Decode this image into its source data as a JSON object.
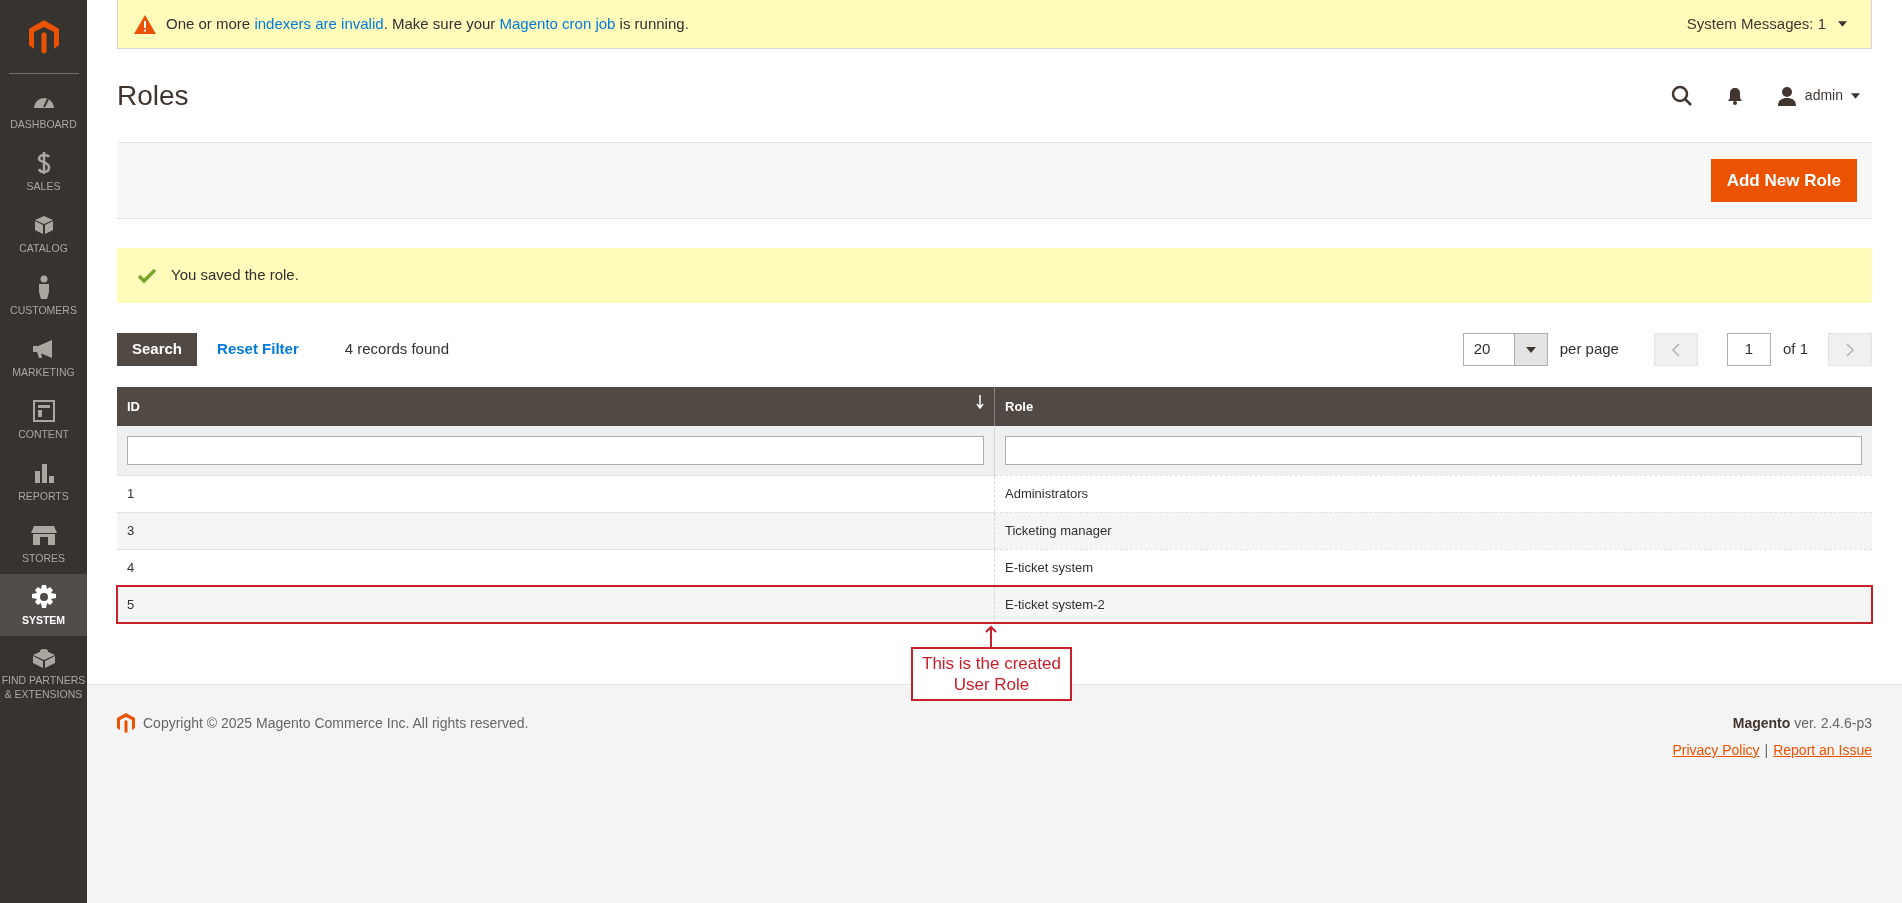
{
  "sidebar": {
    "items": [
      {
        "label": "DASHBOARD",
        "selected": false
      },
      {
        "label": "SALES",
        "selected": false
      },
      {
        "label": "CATALOG",
        "selected": false
      },
      {
        "label": "CUSTOMERS",
        "selected": false
      },
      {
        "label": "MARKETING",
        "selected": false
      },
      {
        "label": "CONTENT",
        "selected": false
      },
      {
        "label": "REPORTS",
        "selected": false
      },
      {
        "label": "STORES",
        "selected": false
      },
      {
        "label": "SYSTEM",
        "selected": true
      },
      {
        "label": "FIND PARTNERS\n& EXTENSIONS",
        "selected": false
      }
    ]
  },
  "system_message": {
    "parts": [
      {
        "text": "One or more ",
        "kind": "text"
      },
      {
        "text": "indexers are invalid",
        "kind": "link"
      },
      {
        "text": ". Make sure your ",
        "kind": "text"
      },
      {
        "text": "Magento cron job",
        "kind": "link"
      },
      {
        "text": " is running.",
        "kind": "text"
      }
    ],
    "counter": "System Messages: 1"
  },
  "page_title": "Roles",
  "header": {
    "user": "admin"
  },
  "actions": {
    "primary_button": "Add New Role"
  },
  "success_message": "You saved the role.",
  "toolbar": {
    "search_button": "Search",
    "reset_link": "Reset Filter",
    "records": "4 records found",
    "per_page_value": "20",
    "per_page_label": "per page",
    "page_value": "1",
    "page_total": "of 1"
  },
  "table": {
    "columns": [
      {
        "label": "ID",
        "sorted": true
      },
      {
        "label": "Role",
        "sorted": false
      }
    ],
    "rows": [
      {
        "cells": [
          "1",
          "Administrators"
        ],
        "highlighted": false
      },
      {
        "cells": [
          "3",
          "Ticketing manager"
        ],
        "highlighted": false
      },
      {
        "cells": [
          "4",
          "E-ticket system"
        ],
        "highlighted": false
      },
      {
        "cells": [
          "5",
          "E-ticket system-2"
        ],
        "highlighted": true
      }
    ]
  },
  "annotation": {
    "text": "This is the created\nUser Role"
  },
  "footer": {
    "copyright": "Copyright © 2025 Magento Commerce Inc. All rights reserved.",
    "brand": "Magento",
    "version": " ver. 2.4.6-p3",
    "links": [
      "Privacy Policy",
      "Report an Issue"
    ],
    "separator": "|"
  }
}
